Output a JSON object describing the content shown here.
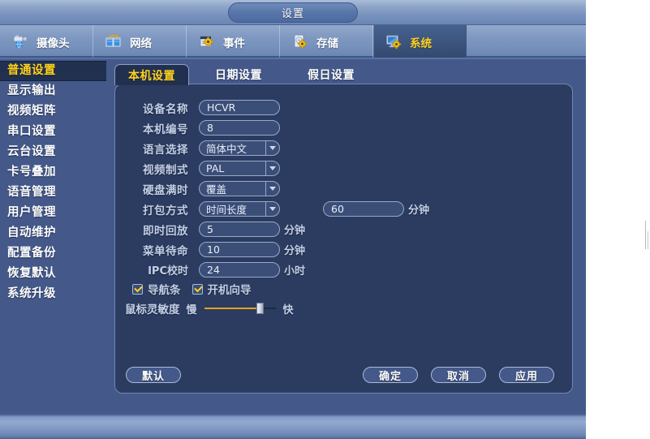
{
  "window": {
    "title": "设置"
  },
  "nav": {
    "items": [
      {
        "label": "摄像头",
        "icon": "camera-icon",
        "active": false
      },
      {
        "label": "网络",
        "icon": "network-icon",
        "active": false
      },
      {
        "label": "事件",
        "icon": "event-icon",
        "active": false
      },
      {
        "label": "存储",
        "icon": "storage-icon",
        "active": false
      },
      {
        "label": "系统",
        "icon": "system-icon",
        "active": true
      }
    ],
    "active_color": "#ffd21e"
  },
  "sidebar": {
    "items": [
      {
        "label": "普通设置",
        "active": true
      },
      {
        "label": "显示输出",
        "active": false
      },
      {
        "label": "视频矩阵",
        "active": false
      },
      {
        "label": "串口设置",
        "active": false
      },
      {
        "label": "云台设置",
        "active": false
      },
      {
        "label": "卡号叠加",
        "active": false
      },
      {
        "label": "语音管理",
        "active": false
      },
      {
        "label": "用户管理",
        "active": false
      },
      {
        "label": "自动维护",
        "active": false
      },
      {
        "label": "配置备份",
        "active": false
      },
      {
        "label": "恢复默认",
        "active": false
      },
      {
        "label": "系统升级",
        "active": false
      }
    ]
  },
  "tabs": [
    {
      "label": "本机设置",
      "active": true
    },
    {
      "label": "日期设置",
      "active": false
    },
    {
      "label": "假日设置",
      "active": false
    }
  ],
  "form": {
    "device_name": {
      "label": "设备名称",
      "value": "HCVR"
    },
    "device_no": {
      "label": "本机编号",
      "value": "8"
    },
    "language": {
      "label": "语言选择",
      "value": "简体中文"
    },
    "video_standard": {
      "label": "视频制式",
      "value": "PAL"
    },
    "hdd_full": {
      "label": "硬盘满时",
      "value": "覆盖"
    },
    "pack_mode": {
      "label": "打包方式",
      "value": "时间长度"
    },
    "pack_duration": {
      "value": "60",
      "unit": "分钟"
    },
    "instant_playback": {
      "label": "即时回放",
      "value": "5",
      "unit": "分钟"
    },
    "menu_standby": {
      "label": "菜单待命",
      "value": "10",
      "unit": "分钟"
    },
    "ipc_time_sync": {
      "label": "IPC校时",
      "value": "24",
      "unit": "小时"
    },
    "nav_bar": {
      "label": "导航条",
      "checked": true
    },
    "startup_wizard": {
      "label": "开机向导",
      "checked": true
    },
    "mouse_sensitivity": {
      "label": "鼠标灵敏度",
      "slow_label": "慢",
      "fast_label": "快",
      "value": 73,
      "fill_color": "#e8a020"
    }
  },
  "buttons": {
    "defaults": "默认",
    "ok": "确定",
    "cancel": "取消",
    "apply": "应用"
  }
}
